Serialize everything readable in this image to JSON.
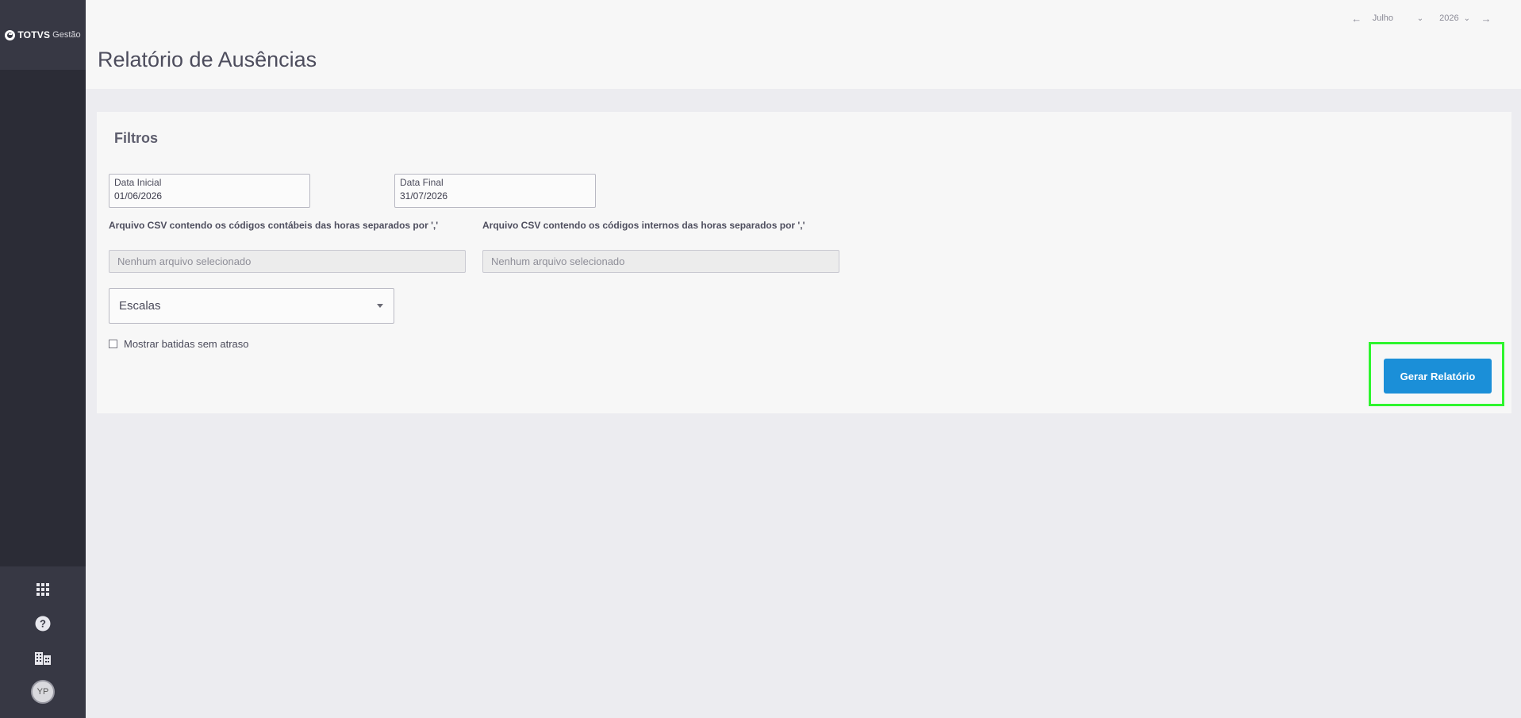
{
  "app": {
    "brand": "TOTVS",
    "product": "Gestão"
  },
  "header": {
    "title": "Relatório de Ausências",
    "period": {
      "month": "Julho",
      "year": "2026"
    }
  },
  "filters": {
    "title": "Filtros",
    "start_date": {
      "label": "Data Inicial",
      "value": "01/06/2026"
    },
    "end_date": {
      "label": "Data Final",
      "value": "31/07/2026"
    },
    "csv_accounting": {
      "label": "Arquivo CSV contendo os códigos contábeis das horas separados por ','",
      "placeholder": "Nenhum arquivo selecionado"
    },
    "csv_internal": {
      "label": "Arquivo CSV contendo os códigos internos das horas separados por ','",
      "placeholder": "Nenhum arquivo selecionado"
    },
    "scales": {
      "placeholder": "Escalas"
    },
    "show_punches": {
      "label": "Mostrar batidas sem atraso",
      "checked": false
    },
    "submit_label": "Gerar Relatório"
  },
  "sidebar": {
    "icons": [
      "apps-grid-icon",
      "help-icon",
      "company-icon"
    ],
    "user_initials": "YP"
  },
  "colors": {
    "primary": "#1b8fd8",
    "sidebar": "#2b2c36",
    "highlight": "#2ef52e"
  }
}
